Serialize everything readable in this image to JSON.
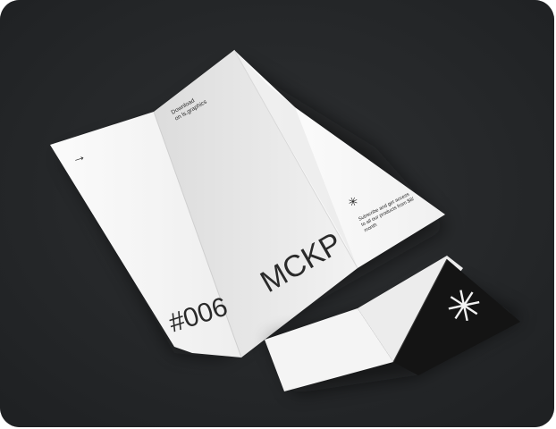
{
  "scene": {
    "brochure": {
      "arrow": "→",
      "download_text": [
        "Download",
        "on ls.graphics"
      ],
      "title": "MCKP",
      "number": "#006",
      "asterisk": "✳",
      "subscribe_text": [
        "Subscribe and get access",
        "to all our products from $8/",
        "month"
      ]
    },
    "card": {
      "asterisk": "✳"
    },
    "colors": {
      "background": "#27292b",
      "paper": "#f3f3f3",
      "card_dark": "#161616"
    }
  }
}
